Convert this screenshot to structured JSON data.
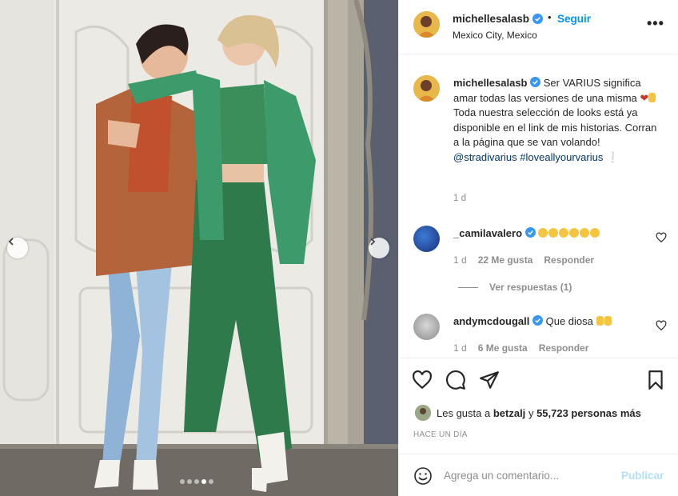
{
  "post": {
    "username": "michellesalasb",
    "follow_label": "Seguir",
    "separator": "•",
    "location": "Mexico City, Mexico",
    "more_label": "•••",
    "caption": {
      "username": "michellesalasb",
      "text_1": "Ser VARIUS significa amar todas las versiones de una misma",
      "text_2": "Toda nuestra selección de looks está ya disponible en el link de mis historias. Corran a la página que se van volando!",
      "mention": "@stradivarius",
      "hashtag": "#loveallyourvarius",
      "time": "1 d"
    }
  },
  "comments": [
    {
      "username": "_camilavalero",
      "text": "",
      "time": "1 d",
      "likes": "22 Me gusta",
      "reply": "Responder"
    },
    {
      "username": "andymcdougall",
      "text": "Que diosa",
      "time": "1 d",
      "likes": "6 Me gusta",
      "reply": "Responder"
    }
  ],
  "view_replies": "Ver respuestas (1)",
  "likes": {
    "prefix": "Les gusta a",
    "user": "betzalj",
    "connector": "y",
    "others": "55,723 personas más"
  },
  "time_ago": "HACE UN DÍA",
  "add_comment": {
    "placeholder": "Agrega un comentario...",
    "publish_label": "Publicar"
  },
  "carousel": {
    "total": 5,
    "active_index": 3
  },
  "colors": {
    "link_blue": "#0095f6",
    "publish_disabled": "#b2dffc",
    "verified": "#3897f0",
    "secondary_text": "#8e8e8e"
  }
}
